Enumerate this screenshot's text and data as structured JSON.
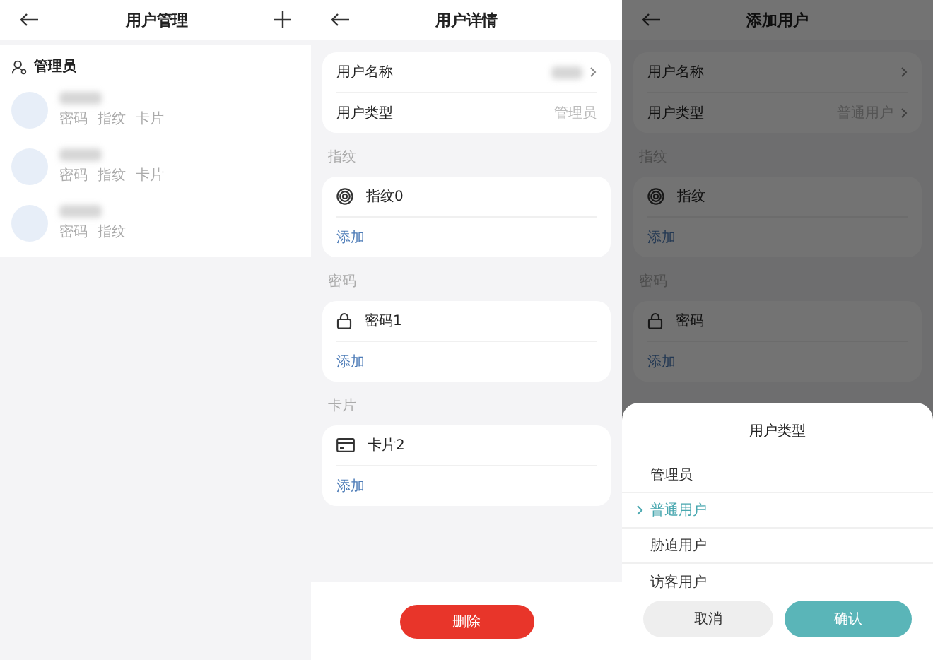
{
  "user_list": {
    "title": "用户管理",
    "group": {
      "label": "管理员",
      "users": [
        {
          "methods": [
            "密码",
            "指纹",
            "卡片"
          ]
        },
        {
          "methods": [
            "密码",
            "指纹",
            "卡片"
          ]
        },
        {
          "methods": [
            "密码",
            "指纹"
          ]
        }
      ]
    }
  },
  "user_detail": {
    "title": "用户详情",
    "fields": [
      {
        "label": "用户名称",
        "blurred_value": true,
        "arrow": true
      },
      {
        "label": "用户类型",
        "value": "管理员",
        "blurred_value": false,
        "arrow": false
      }
    ],
    "sections": [
      {
        "label": "指纹",
        "kind": "fingerprint",
        "items": [
          "指纹0"
        ],
        "add": "添加"
      },
      {
        "label": "密码",
        "kind": "password",
        "items": [
          "密码1"
        ],
        "add": "添加"
      },
      {
        "label": "卡片",
        "kind": "card",
        "items": [
          "卡片2"
        ],
        "add": "添加"
      }
    ],
    "delete_button": "删除"
  },
  "add_user": {
    "title": "添加用户",
    "fields": [
      {
        "label": "用户名称",
        "blurred_value": false,
        "arrow": true
      },
      {
        "label": "用户类型",
        "value": "普通用户",
        "blurred_value": false,
        "arrow": true
      }
    ],
    "sections": [
      {
        "label": "指纹",
        "kind": "fingerprint",
        "items": [
          "指纹"
        ],
        "add": "添加"
      },
      {
        "label": "密码",
        "kind": "password",
        "items": [
          "密码"
        ],
        "add": "添加"
      }
    ],
    "sheet": {
      "title": "用户类型",
      "options": [
        {
          "label": "管理员",
          "selected": false
        },
        {
          "label": "普通用户",
          "selected": true
        },
        {
          "label": "胁迫用户",
          "selected": false
        },
        {
          "label": "访客用户",
          "selected": false
        }
      ],
      "cancel": "取消",
      "confirm": "确认"
    }
  }
}
